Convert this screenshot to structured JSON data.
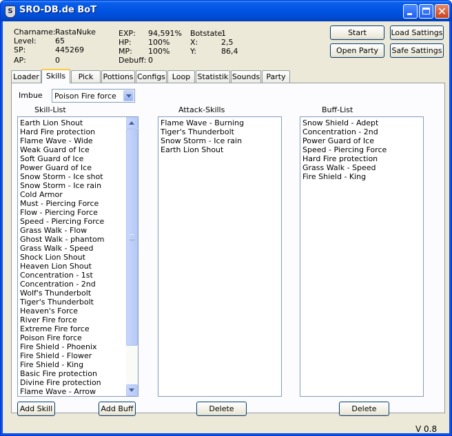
{
  "window": {
    "title": "SRO-DB.de BoT",
    "icon": "shield-icon"
  },
  "stats": {
    "charname_label": "Charname:",
    "charname": "RastaNuke",
    "level_label": "Level:",
    "level": "65",
    "sp_label": "SP:",
    "sp": "445269",
    "ap_label": "AP:",
    "ap": "0",
    "exp_label": "EXP:",
    "exp": "94,591%",
    "hp_label": "HP:",
    "hp": "100%",
    "mp_label": "MP:",
    "mp": "100%",
    "debuff_label": "Debuff:",
    "debuff": "0",
    "botstate_label": "Botstate:",
    "botstate": "1",
    "x_label": "X:",
    "x": "2,5",
    "y_label": "Y:",
    "y": "86,4"
  },
  "buttons": {
    "start": "Start",
    "load_settings": "Load Sattings",
    "open_party": "Open Party",
    "safe_settings": "Safe Sattings",
    "add_skill": "Add Skill",
    "add_buff": "Add Buff",
    "delete_attack": "Delete",
    "delete_buff": "Delete"
  },
  "tabs": [
    "Loader",
    "Skills",
    "Pick",
    "Pottions",
    "Configs",
    "Loop",
    "Statistik",
    "Sounds",
    "Party"
  ],
  "active_tab": "Skills",
  "skills_tab": {
    "imbue_label": "Imbue",
    "imbue_value": "Poison Fire force",
    "skill_list_label": "Skill-List",
    "attack_skills_label": "Attack-Skills",
    "buff_list_label": "Buff-List",
    "skill_list": [
      "Earth Lion Shout",
      "Hard Fire protection",
      "Flame Wave - Wide",
      "Weak Guard of Ice",
      "Soft Guard of Ice",
      "Power Guard of Ice",
      "Snow Storm - Ice shot",
      "Snow Storm - Ice rain",
      "Cold Armor",
      "Must - Piercing Force",
      "Flow - Piercing Force",
      "Speed - Piercing Force",
      "Grass Walk - Flow",
      "Ghost Walk - phantom",
      "Grass Walk - Speed",
      "Shock Lion Shout",
      "Heaven Lion Shout",
      "Concentration - 1st",
      "Concentration - 2nd",
      "Wolf's Thunderbolt",
      "Tiger's Thunderbolt",
      "Heaven's Force",
      "River Fire force",
      "Extreme Fire force",
      "Poison Fire force",
      "Fire Shield - Phoenix",
      "Fire Shield - Flower",
      "Fire Shield - King",
      "Basic Fire protection",
      "Divine Fire protection",
      "Flame Wave - Arrow"
    ],
    "attack_skills": [
      "Flame Wave - Burning",
      "Tiger's Thunderbolt",
      "Snow Storm - Ice rain",
      "Earth Lion Shout"
    ],
    "buff_list": [
      "Snow Shield - Adept",
      "Concentration - 2nd",
      "Power Guard of Ice",
      "Speed - Piercing Force",
      "Hard Fire protection",
      "Grass Walk - Speed",
      "Fire Shield - King"
    ]
  },
  "version": "V 0.8",
  "colors": {
    "titlebar": "#0054e3",
    "client_bg": "#ece9d8",
    "tab_highlight": "#ffc83c",
    "list_border": "#7f9db9"
  }
}
